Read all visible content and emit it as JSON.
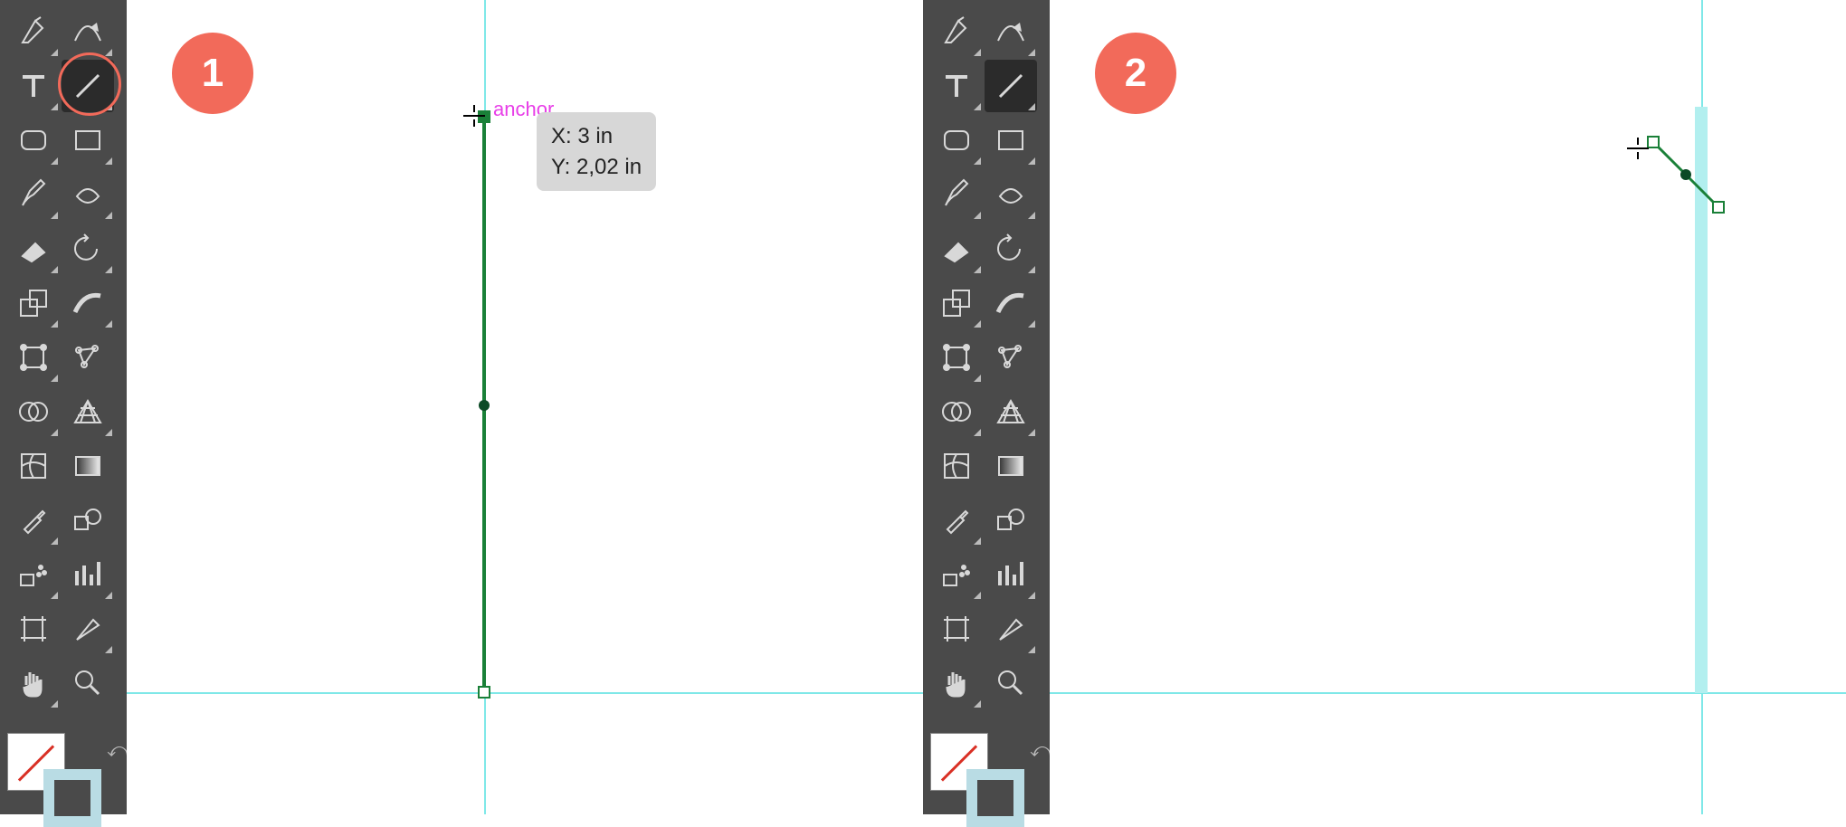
{
  "steps": [
    {
      "badge": "1"
    },
    {
      "badge": "2"
    }
  ],
  "smart_guide_label": "anchor",
  "tooltip": {
    "line1": "X: 3 in",
    "line2": "Y: 2,02 in"
  },
  "tools": [
    {
      "id": "pen-tool",
      "row": 0,
      "col": 0,
      "flyout": true
    },
    {
      "id": "curvature-tool",
      "row": 0,
      "col": 1,
      "flyout": true
    },
    {
      "id": "type-tool",
      "row": 1,
      "col": 0,
      "flyout": true
    },
    {
      "id": "line-segment-tool",
      "row": 1,
      "col": 1,
      "flyout": true,
      "selected": true
    },
    {
      "id": "rounded-rect-tool",
      "row": 2,
      "col": 0,
      "flyout": true
    },
    {
      "id": "rectangle-tool",
      "row": 2,
      "col": 1,
      "flyout": true
    },
    {
      "id": "paintbrush-tool",
      "row": 3,
      "col": 0,
      "flyout": true
    },
    {
      "id": "shaper-tool",
      "row": 3,
      "col": 1,
      "flyout": true
    },
    {
      "id": "eraser-tool",
      "row": 4,
      "col": 0,
      "flyout": true
    },
    {
      "id": "rotate-tool",
      "row": 4,
      "col": 1,
      "flyout": true
    },
    {
      "id": "scale-tool",
      "row": 5,
      "col": 0,
      "flyout": true
    },
    {
      "id": "width-tool",
      "row": 5,
      "col": 1,
      "flyout": true
    },
    {
      "id": "free-transform-tool",
      "row": 6,
      "col": 0,
      "flyout": true
    },
    {
      "id": "puppet-warp-tool",
      "row": 6,
      "col": 1,
      "flyout": false
    },
    {
      "id": "shape-builder-tool",
      "row": 7,
      "col": 0,
      "flyout": true
    },
    {
      "id": "perspective-grid-tool",
      "row": 7,
      "col": 1,
      "flyout": true
    },
    {
      "id": "mesh-tool",
      "row": 8,
      "col": 0,
      "flyout": false
    },
    {
      "id": "gradient-tool",
      "row": 8,
      "col": 1,
      "flyout": false
    },
    {
      "id": "eyedropper-tool",
      "row": 9,
      "col": 0,
      "flyout": true
    },
    {
      "id": "blend-tool",
      "row": 9,
      "col": 1,
      "flyout": false
    },
    {
      "id": "symbol-sprayer-tool",
      "row": 10,
      "col": 0,
      "flyout": true
    },
    {
      "id": "column-graph-tool",
      "row": 10,
      "col": 1,
      "flyout": true
    },
    {
      "id": "artboard-tool",
      "row": 11,
      "col": 0,
      "flyout": false
    },
    {
      "id": "slice-tool",
      "row": 11,
      "col": 1,
      "flyout": true
    },
    {
      "id": "hand-tool",
      "row": 12,
      "col": 0,
      "flyout": true
    },
    {
      "id": "zoom-tool",
      "row": 12,
      "col": 1,
      "flyout": false
    }
  ],
  "colors": {
    "accent_badge": "#f26a5a",
    "guide": "#7fe8e8",
    "path": "#1a8038",
    "smart_guide_text": "#e83ee8"
  }
}
